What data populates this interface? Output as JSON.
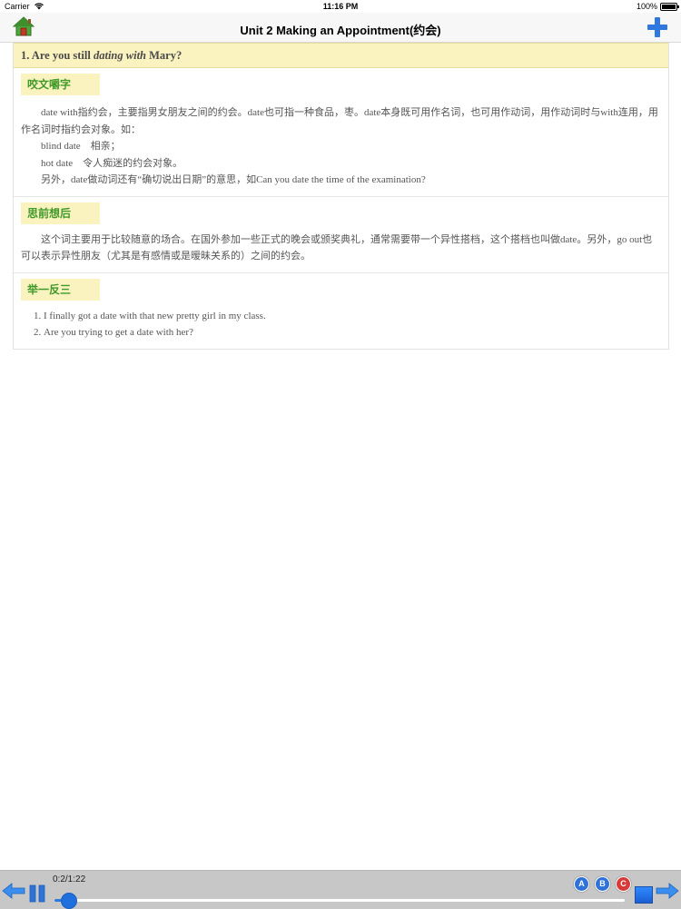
{
  "status_bar": {
    "carrier": "Carrier",
    "time": "11:16 PM",
    "battery": "100%"
  },
  "nav_bar": {
    "title": "Unit 2 Making an Appointment(约会)",
    "home_icon": "home-icon",
    "add_icon": "plus-icon"
  },
  "lesson": {
    "heading_prefix": "1. Are you still ",
    "heading_emphasis": "dating with",
    "heading_suffix": " Mary?",
    "sections": [
      {
        "tag": "咬文嚼字",
        "lines": [
          "date with指约会，主要指男女朋友之间的约会。date也可指一种食品，枣。date本身既可用作名词，也可用作动词，用作动词时与with连用，用作名词时指约会对象。如：",
          "blind date    相亲；",
          "hot date    令人痴迷的约会对象。",
          "另外，date做动词还有“确切说出日期”的意思，如Can you date the time of the examination?"
        ]
      },
      {
        "tag": "思前想后",
        "lines": [
          "这个词主要用于比较随意的场合。在国外参加一些正式的晚会或颁奖典礼，通常需要带一个异性搭档，这个搭档也叫做date。另外，go out也可以表示异性朋友（尤其是有感情或是暧昧关系的）之间的约会。"
        ]
      },
      {
        "tag": "举一反三",
        "examples": [
          "I finally got a date with that new pretty girl in my class.",
          "Are you trying to get a date with her?"
        ]
      }
    ]
  },
  "player": {
    "time_display": "0:2/1:22",
    "progress": 0.025,
    "buttons": {
      "a": "A",
      "b": "B",
      "c": "C"
    },
    "colors": {
      "accent": "#1f6fdd",
      "c_button": "#d83a3a"
    }
  }
}
